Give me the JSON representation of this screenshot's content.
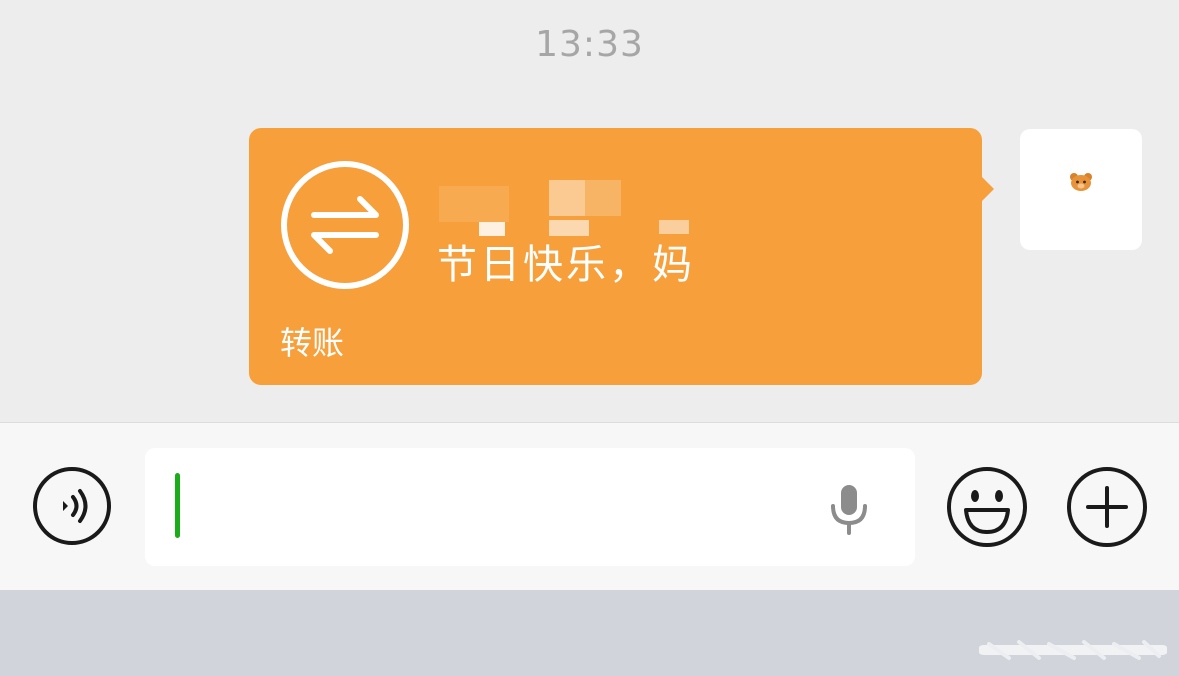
{
  "chat": {
    "timestamp": "13:33",
    "transfer_card": {
      "message": "节日快乐，妈",
      "type_label": "转账",
      "icon": "transfer-arrows-icon",
      "color": "#f79f3a"
    },
    "avatar": {
      "icon": "bear-avatar-icon"
    }
  },
  "input_bar": {
    "voice_button_icon": "voice-wave-icon",
    "input_value": "",
    "mic_icon": "microphone-icon",
    "emoji_icon": "smiley-icon",
    "plus_icon": "plus-icon",
    "cursor_color": "#1aad19"
  }
}
